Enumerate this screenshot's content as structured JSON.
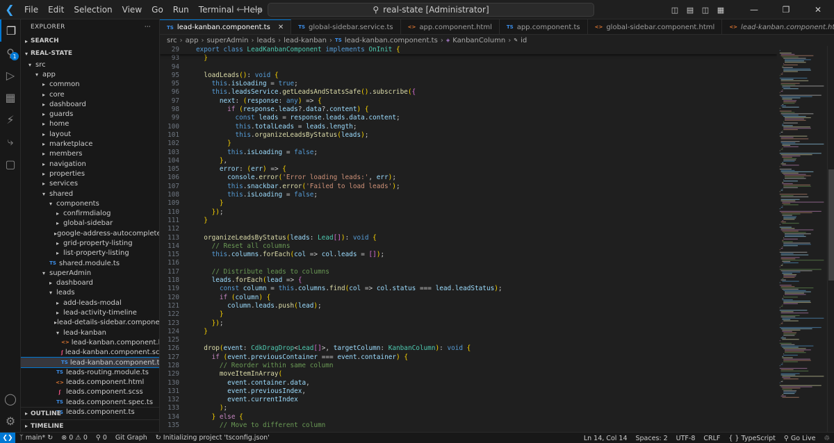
{
  "titlebar": {
    "menu": [
      "File",
      "Edit",
      "Selection",
      "View",
      "Go",
      "Run",
      "Terminal",
      "Help"
    ],
    "search_text": "real-state [Administrator]"
  },
  "sidebar": {
    "title": "EXPLORER",
    "search_section": "SEARCH",
    "root_section": "REAL-STATE",
    "items": [
      {
        "label": "src",
        "depth": 0,
        "kind": "folder-open"
      },
      {
        "label": "app",
        "depth": 1,
        "kind": "folder-open"
      },
      {
        "label": "common",
        "depth": 2,
        "kind": "folder"
      },
      {
        "label": "core",
        "depth": 2,
        "kind": "folder"
      },
      {
        "label": "dashboard",
        "depth": 2,
        "kind": "folder"
      },
      {
        "label": "guards",
        "depth": 2,
        "kind": "folder"
      },
      {
        "label": "home",
        "depth": 2,
        "kind": "folder"
      },
      {
        "label": "layout",
        "depth": 2,
        "kind": "folder"
      },
      {
        "label": "marketplace",
        "depth": 2,
        "kind": "folder"
      },
      {
        "label": "members",
        "depth": 2,
        "kind": "folder"
      },
      {
        "label": "navigation",
        "depth": 2,
        "kind": "folder"
      },
      {
        "label": "properties",
        "depth": 2,
        "kind": "folder"
      },
      {
        "label": "services",
        "depth": 2,
        "kind": "folder"
      },
      {
        "label": "shared",
        "depth": 2,
        "kind": "folder-open"
      },
      {
        "label": "components",
        "depth": 3,
        "kind": "folder-open"
      },
      {
        "label": "confirmdialog",
        "depth": 4,
        "kind": "folder"
      },
      {
        "label": "global-sidebar",
        "depth": 4,
        "kind": "folder"
      },
      {
        "label": "google-address-autocomplete",
        "depth": 4,
        "kind": "folder"
      },
      {
        "label": "grid-property-listing",
        "depth": 4,
        "kind": "folder"
      },
      {
        "label": "list-property-listing",
        "depth": 4,
        "kind": "folder"
      },
      {
        "label": "shared.module.ts",
        "depth": 3,
        "kind": "ts"
      },
      {
        "label": "superAdmin",
        "depth": 2,
        "kind": "folder-open"
      },
      {
        "label": "dashboard",
        "depth": 3,
        "kind": "folder"
      },
      {
        "label": "leads",
        "depth": 3,
        "kind": "folder-open"
      },
      {
        "label": "add-leads-modal",
        "depth": 4,
        "kind": "folder"
      },
      {
        "label": "lead-activity-timeline",
        "depth": 4,
        "kind": "folder"
      },
      {
        "label": "lead-details-sidebar.component.ts",
        "depth": 4,
        "kind": "folder"
      },
      {
        "label": "lead-kanban",
        "depth": 4,
        "kind": "folder-open"
      },
      {
        "label": "lead-kanban.component.html",
        "depth": 5,
        "kind": "html"
      },
      {
        "label": "lead-kanban.component.scss",
        "depth": 5,
        "kind": "scss"
      },
      {
        "label": "lead-kanban.component.ts",
        "depth": 5,
        "kind": "ts",
        "selected": true
      },
      {
        "label": "leads-routing.module.ts",
        "depth": 4,
        "kind": "ts"
      },
      {
        "label": "leads.component.html",
        "depth": 4,
        "kind": "html"
      },
      {
        "label": "leads.component.scss",
        "depth": 4,
        "kind": "scss"
      },
      {
        "label": "leads.component.spec.ts",
        "depth": 4,
        "kind": "ts"
      },
      {
        "label": "leads.component.ts",
        "depth": 4,
        "kind": "ts"
      }
    ],
    "outline": "OUTLINE",
    "timeline": "TIMELINE"
  },
  "tabs": [
    {
      "label": "lead-kanban.component.ts",
      "icon": "TS",
      "active": true
    },
    {
      "label": "global-sidebar.service.ts",
      "icon": "TS"
    },
    {
      "label": "app.component.html",
      "icon": "<>"
    },
    {
      "label": "app.component.ts",
      "icon": "TS"
    },
    {
      "label": "global-sidebar.component.html",
      "icon": "<>"
    },
    {
      "label": "lead-kanban.component.html",
      "icon": "<>",
      "italic": true
    },
    {
      "label": "global-sidebar.compone",
      "icon": "TS"
    }
  ],
  "breadcrumb": [
    "src",
    "app",
    "superAdmin",
    "leads",
    "lead-kanban",
    "lead-kanban.component.ts",
    "KanbanColumn",
    "id"
  ],
  "editor": {
    "sticky": {
      "n": "29",
      "code": "export class LeadKanbanComponent implements OnInit {"
    },
    "lines": [
      {
        "n": "93",
        "code": "  }"
      },
      {
        "n": "94",
        "code": ""
      },
      {
        "n": "95",
        "code": "  loadLeads(): void {"
      },
      {
        "n": "95",
        "code": "    this.isLoading = true;"
      },
      {
        "n": "96",
        "code": "    this.leadsService.getLeadsAndStatsSafe().subscribe({"
      },
      {
        "n": "97",
        "code": "      next: (response: any) => {"
      },
      {
        "n": "98",
        "code": "        if (response.leads?.data?.content) {"
      },
      {
        "n": "99",
        "code": "          const leads = response.leads.data.content;"
      },
      {
        "n": "100",
        "code": "          this.totalLeads = leads.length;"
      },
      {
        "n": "101",
        "code": "          this.organizeLeadsByStatus(leads);"
      },
      {
        "n": "102",
        "code": "        }"
      },
      {
        "n": "103",
        "code": "        this.isLoading = false;"
      },
      {
        "n": "104",
        "code": "      },"
      },
      {
        "n": "105",
        "code": "      error: (err) => {"
      },
      {
        "n": "106",
        "code": "        console.error('Error loading leads:', err);"
      },
      {
        "n": "107",
        "code": "        this.snackbar.error('Failed to load leads');"
      },
      {
        "n": "108",
        "code": "        this.isLoading = false;"
      },
      {
        "n": "109",
        "code": "      }"
      },
      {
        "n": "110",
        "code": "    });"
      },
      {
        "n": "111",
        "code": "  }"
      },
      {
        "n": "112",
        "code": ""
      },
      {
        "n": "113",
        "code": "  organizeLeadsByStatus(leads: Lead[]): void {"
      },
      {
        "n": "114",
        "code": "    // Reset all columns"
      },
      {
        "n": "115",
        "code": "    this.columns.forEach(col => col.leads = []);"
      },
      {
        "n": "116",
        "code": ""
      },
      {
        "n": "117",
        "code": "    // Distribute leads to columns"
      },
      {
        "n": "118",
        "code": "    leads.forEach(lead => {"
      },
      {
        "n": "119",
        "code": "      const column = this.columns.find(col => col.status === lead.leadStatus);"
      },
      {
        "n": "120",
        "code": "      if (column) {"
      },
      {
        "n": "121",
        "code": "        column.leads.push(lead);"
      },
      {
        "n": "122",
        "code": "      }"
      },
      {
        "n": "123",
        "code": "    });"
      },
      {
        "n": "124",
        "code": "  }"
      },
      {
        "n": "125",
        "code": ""
      },
      {
        "n": "126",
        "code": "  drop(event: CdkDragDrop<Lead[]>, targetColumn: KanbanColumn): void {"
      },
      {
        "n": "127",
        "code": "    if (event.previousContainer === event.container) {"
      },
      {
        "n": "128",
        "code": "      // Reorder within same column"
      },
      {
        "n": "129",
        "code": "      moveItemInArray("
      },
      {
        "n": "130",
        "code": "        event.container.data,"
      },
      {
        "n": "131",
        "code": "        event.previousIndex,"
      },
      {
        "n": "132",
        "code": "        event.currentIndex"
      },
      {
        "n": "133",
        "code": "      );"
      },
      {
        "n": "134",
        "code": "    } else {"
      },
      {
        "n": "135",
        "code": "      // Move to different column"
      }
    ]
  },
  "statusbar": {
    "branch": "main*",
    "errors": "0",
    "warnings": "0",
    "ports": "0",
    "git_graph": "Git Graph",
    "initializing": "Initializing project 'tsconfig.json'",
    "position": "Ln 14, Col 14",
    "spaces": "Spaces: 2",
    "encoding": "UTF-8",
    "eol": "CRLF",
    "language": "TypeScript",
    "golive": "Go Live"
  },
  "colors": {
    "accent": "#0078d4",
    "keyword": "#569cd6",
    "control": "#c586c0",
    "function": "#dcdcaa",
    "variable": "#9cdcfe",
    "type": "#4ec9b0",
    "string": "#ce9178",
    "comment": "#6a9955"
  }
}
